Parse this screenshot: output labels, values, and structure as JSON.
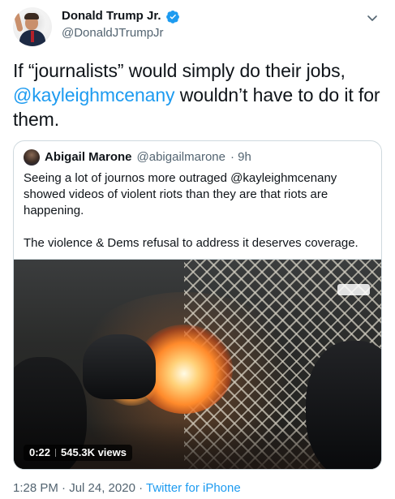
{
  "author": {
    "name": "Donald Trump Jr.",
    "handle": "@DonaldJTrumpJr"
  },
  "tweet": {
    "text_before": "If “journalists” would simply do their jobs, ",
    "mention": "@kayleighmcenany",
    "text_after": " wouldn’t have to do it for them."
  },
  "quoted": {
    "name": "Abigail Marone",
    "handle": "@abigailmarone",
    "time": "· 9h",
    "paragraph1": "Seeing a lot of journos more outraged @kayleighmcenany showed videos of violent riots than they are that riots are happening.",
    "paragraph2": "The violence & Dems refusal to address it deserves coverage.",
    "video": {
      "duration": "0:22",
      "views": "545.3K views"
    }
  },
  "meta": {
    "time": "1:28 PM · Jul 24, 2020 · ",
    "source": "Twitter for iPhone"
  },
  "colors": {
    "accent": "#1d9bf0",
    "text": "#0f1419",
    "secondary": "#536471",
    "border": "#cfd9de"
  }
}
